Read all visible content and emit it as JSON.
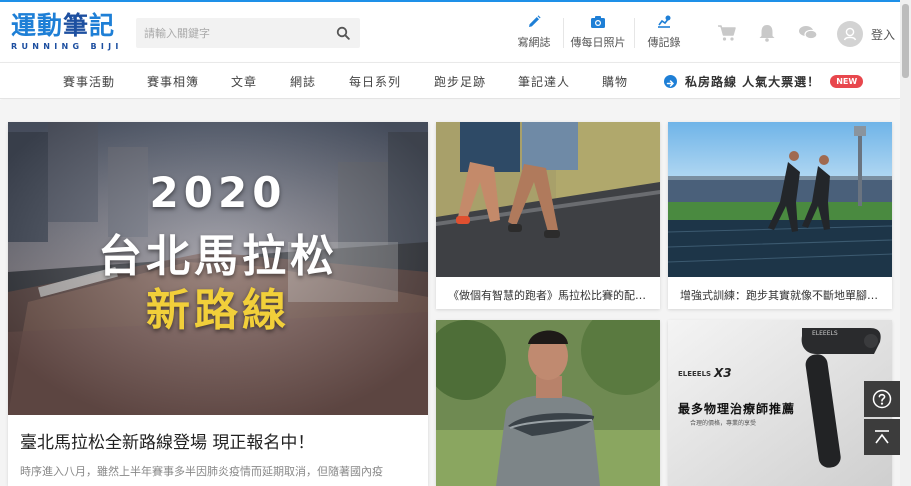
{
  "header": {
    "logo_zh_1": "運動",
    "logo_zh_2": "筆",
    "logo_zh_3": "記",
    "logo_en": "RUNNING BIJI",
    "search_placeholder": "請輸入關鍵字",
    "buttons": [
      {
        "label": "寫網誌",
        "icon": "pencil-icon"
      },
      {
        "label": "傳每日照片",
        "icon": "camera-icon"
      },
      {
        "label": "傳記錄",
        "icon": "upload-record-icon"
      }
    ],
    "login_label": "登入"
  },
  "nav": {
    "items": [
      "賽事活動",
      "賽事相簿",
      "文章",
      "網誌",
      "每日系列",
      "跑步足跡",
      "筆記達人",
      "購物"
    ],
    "promo_text": "私房路線 人氣大票選！",
    "promo_badge": "NEW"
  },
  "feature": {
    "image_line1": "2020",
    "image_line2": "台北馬拉松",
    "image_line3": "新路線",
    "title": "臺北馬拉松全新路線登場 現正報名中！",
    "excerpt": "時序進入八月，雖然上半年賽事多半因肺炎疫情而延期取消，但隨著國內疫"
  },
  "cards": [
    {
      "caption": "《做個有智慧的跑者》馬拉松比賽的配速..."
    },
    {
      "caption": "增強式訓練：跑步其實就像不斷地單腳蹲..."
    },
    {
      "caption": ""
    },
    {
      "caption": "",
      "brand": "ELEEELS",
      "model": "X3",
      "headline": "最多物理治療師推薦",
      "subline": "合理的價格，專業的享受",
      "device_brand": "ELEEELS"
    }
  ],
  "colors": {
    "brand_blue": "#1e7fd6",
    "brand_dark": "#1d4fa0",
    "badge_red": "#e8474d",
    "feature_gold": "#f1cf3a"
  }
}
